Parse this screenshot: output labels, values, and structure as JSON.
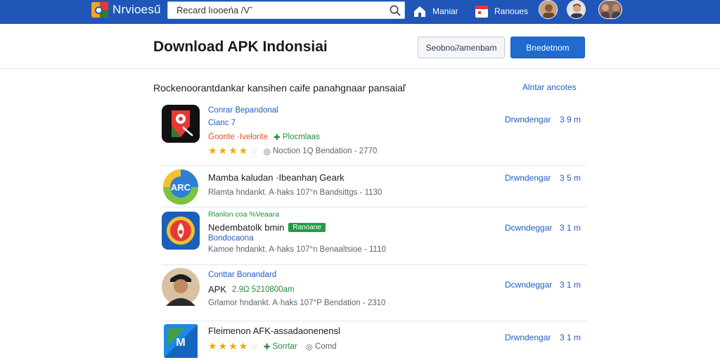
{
  "topbar": {
    "logo_text": "Nrvioesű",
    "search_value": "Ṙecard lıooeńa /Vˇ",
    "nav_home": "Maniar",
    "nav_calendar": "Ranoues"
  },
  "header": {
    "title": "Download APK Indonsiai",
    "secondary_button": "Seobnoᵣ̈/amenbam",
    "primary_button": "Bnedetnom"
  },
  "section": {
    "title": "Rockenoorantdankar kansihen caife panahgnaar pansaiaľ",
    "see_all": "Alntar ancotes"
  },
  "apps": [
    {
      "line1": "Conrar Bepandonal",
      "line2": "Cianc 7",
      "line3_orange": "Ǵoonte ·Ivelorite",
      "line3_green": "Plocmlaas",
      "rating": 3.5,
      "meta": "Noction  1Q  Bendation - 2770",
      "download": "Drwndengar",
      "size": "3 9 m"
    },
    {
      "line1": "Mamba kaludan ·Ibeanhaη Geark",
      "line2": "Rlamta hndankt.   A·haks 107°n  Bandsittgs - 1130",
      "download": "Drwndengar",
      "size": "3 5 m"
    },
    {
      "line1": "Rlanlon coa %Veaara",
      "line2": "Nedembatolk bmin",
      "badge": "Ranoane",
      "line3": "Bondocaona",
      "line4": "Kamoe hndankt.   A·haks 107°n  Benaaltsioe - 1110",
      "download": "Dcwndeggar",
      "size": "3 1 m"
    },
    {
      "line1": "Conttar Bonandard",
      "line2_dark": "APK",
      "line2_green": "2.9Ω  5210800am",
      "line3": "Grlamor hndankt.   A·haks 107°P  Bendation - 2310",
      "download": "Dcwndeggar",
      "size": "3 1 m"
    },
    {
      "line1": "Fleimenon AFK-assadaonenensl",
      "rating": 3.5,
      "line2_green": "Sorrtar",
      "line2_grey": "Comd",
      "download": "Drwndengar",
      "size": "3 1 m"
    }
  ],
  "colors": {
    "topbar": "#1f56b8",
    "primary": "#1f6bd0",
    "link": "#1f5fbf",
    "star": "#f6a700",
    "green": "#1e8e3e",
    "orange": "#d9531e"
  }
}
